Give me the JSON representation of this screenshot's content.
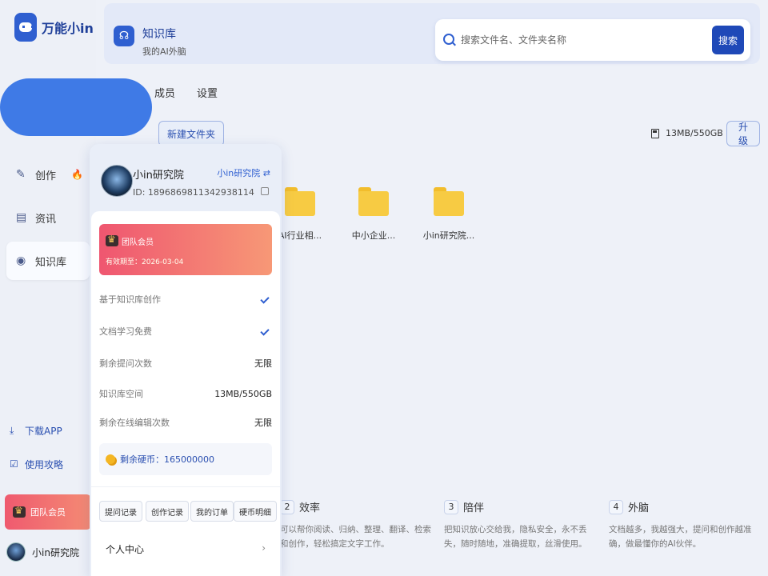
{
  "app": {
    "name": "万能小in"
  },
  "sidebar": {
    "items": [
      {
        "label": "创作",
        "icon": "pencil-icon"
      },
      {
        "label": "资讯",
        "icon": "news-icon"
      },
      {
        "label": "知识库",
        "icon": "brain-icon"
      }
    ],
    "download": "下载APP",
    "guide": "使用攻略",
    "member": "团队会员",
    "user": "小in研究院"
  },
  "header": {
    "title": "知识库",
    "subtitle": "我的AI外脑",
    "search_placeholder": "搜索文件名、文件夹名称",
    "search_button": "搜索"
  },
  "tabs": [
    "成员",
    "设置"
  ],
  "toolbar": {
    "new_folder": "新建文件夹",
    "storage": "13MB/550GB",
    "upgrade": "升级"
  },
  "folders": [
    {
      "label": "AI行业相..."
    },
    {
      "label": "中小企业..."
    },
    {
      "label": "小in研究院..."
    }
  ],
  "features": [
    {
      "num": "2",
      "title": "效率",
      "text": "可以帮你阅读、归纳、整理、翻译、检索和创作，轻松搞定文字工作。"
    },
    {
      "num": "3",
      "title": "陪伴",
      "text": "把知识放心交给我，隐私安全，永不丢失，随时随地，准确提取，丝滑使用。"
    },
    {
      "num": "4",
      "title": "外脑",
      "text": "文档越多，我越强大，提问和创作越准确，做最懂你的AI伙伴。"
    }
  ],
  "popup": {
    "name": "小in研究院",
    "switch": "小in研究院 ⇄",
    "id": "ID: 1896869811342938114",
    "member_title": "团队会员",
    "member_date": "有效期至：2026-03-04",
    "rows": [
      {
        "label": "基于知识库创作",
        "value": ""
      },
      {
        "label": "文档学习免费",
        "value": ""
      },
      {
        "label": "剩余提问次数",
        "value": "无限"
      },
      {
        "label": "知识库空间",
        "value": "13MB/550GB"
      },
      {
        "label": "剩余在线编辑次数",
        "value": "无限"
      }
    ],
    "coins": "剩余硬币：165000000",
    "buttons": [
      "提问记录",
      "创作记录",
      "我的订单",
      "硬币明细"
    ],
    "personal": "个人中心"
  }
}
